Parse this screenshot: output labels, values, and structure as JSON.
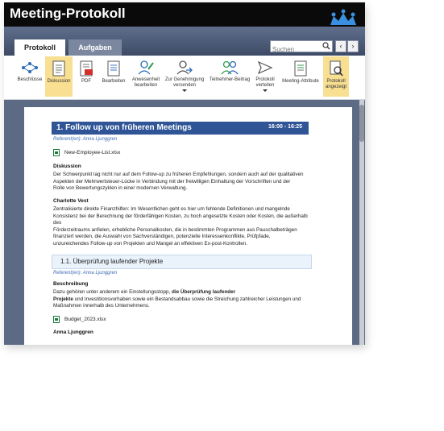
{
  "app": {
    "title": "Meeting-Protokoll"
  },
  "tabs": {
    "protokoll": "Protokoll",
    "aufgaben": "Aufgaben"
  },
  "search": {
    "placeholder": "Suchen"
  },
  "nav": {
    "prev": "‹",
    "next": "›"
  },
  "toolbar": {
    "beschluesse": "Beschlüsse",
    "diskussion": "Diskussion",
    "pdf": "PDF",
    "bearbeiten": "Bearbeiten",
    "anwesenheit_1": "Anwesenheit",
    "anwesenheit_2": "bearbeiten",
    "genehmigung_1": "Zur Genehmigung",
    "genehmigung_2": "versenden",
    "teilnehmer": "Teilnehmer-Beitrag",
    "verteilen_1": "Protokoll",
    "verteilen_2": "verteilen",
    "attribute": "Meeting-Attribute",
    "angezeigt_1": "Protokoll",
    "angezeigt_2": "angezeigt"
  },
  "doc": {
    "section1_title": "1. Follow up von früheren Meetings",
    "section1_time": "16:00 - 16:25",
    "section1_referent": "Referent(en): Anna Ljunggren",
    "attachment1": "New-Employee-List.xlsx",
    "diskussion_heading": "Diskussion",
    "diskussion_l1": "Der Schwerpunkt lag nicht nur auf dem Follow-up zu früheren Empfehlungen, sondern auch auf der qualitativen",
    "diskussion_l2": "Aspekten der Mehrwertsteuer-Lücke in Verbindung mit der freiwilligen Einhaltung der Vorschriften und der",
    "diskussion_l3": "Rolle von Bewertungszyklen in einer modernen Verwaltung.",
    "charlotte_heading": "Charlotte Vest",
    "charlotte_l1": "Zentralisierte direkte Finanzhilfen: Im Wesentlichen geht es hier um fehlende Definitionen und mangelnde",
    "charlotte_l2": "Konsistenz bei der Berechnung der förderfähigen Kosten, zu hoch angesetzte Kosten oder Kosten, die außerhalb des",
    "charlotte_l3": "Förderzeitraums anfielen, erhebliche Personalkosten, die in bestimmten Programmen aus Pauschalbeträgen",
    "charlotte_l4": "finanziert werden, die Auswahl von Sachverständigen, potenzielle Interessenkonflikte, Prüfpfade,",
    "charlotte_l5": "unzureichendes Follow-up von Projekten und Mangel an effektiven Ex-post-Kontrollen.",
    "section2_title": "1.1. Überprüfung laufender Projekte",
    "section2_referent": "Referent(en): Anna Ljunggren",
    "beschreibung_heading": "Beschreibung",
    "beschreibung_l1_a": "Dazu gehören unter anderem ein Einstellungsstopp, ",
    "beschreibung_l1_b": "die Überprüfung laufender",
    "beschreibung_l2_a": "Projekte",
    "beschreibung_l2_b": " und Investitionsvorhaben sowie ein Bestandsabbau sowie die Streichung zahlreicher Leistungen und",
    "beschreibung_l3": "Maßnahmen innerhalb des Unternehmens.",
    "attachment2": "Budget_2023.xlsx",
    "anna_heading": "Anna Ljunggren"
  },
  "colors": {
    "titlebar": "#0a0a0a",
    "tabbar": "#4f5d7a",
    "highlight": "#f8df92",
    "section_header": "#2f5597",
    "subsection_bg": "#eaf2fb",
    "referent": "#3d6cb5"
  }
}
